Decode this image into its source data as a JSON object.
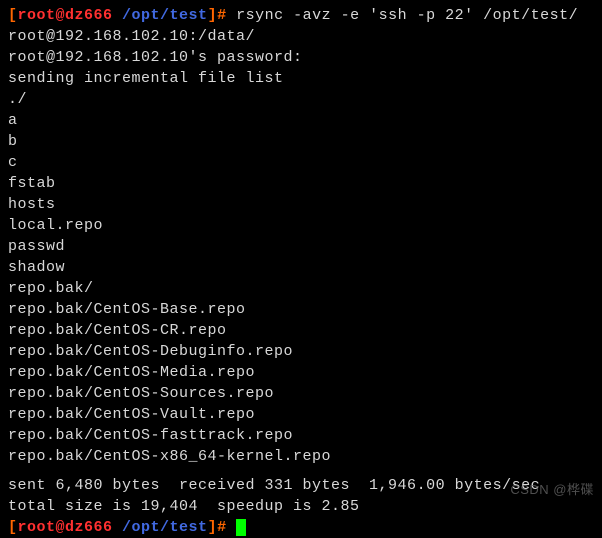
{
  "prompt1": {
    "bracket_l": "[",
    "user": "root@dz666",
    "cwd": "/opt/test",
    "bracket_r": "]#",
    "command": " rsync -avz -e 'ssh -p 22' /opt/test/ root@192.168.102.10:/data/"
  },
  "output": {
    "pw_prompt": "root@192.168.102.10's password:",
    "sending": "sending incremental file list",
    "files": [
      "./",
      "a",
      "b",
      "c",
      "fstab",
      "hosts",
      "local.repo",
      "passwd",
      "shadow",
      "repo.bak/",
      "repo.bak/CentOS-Base.repo",
      "repo.bak/CentOS-CR.repo",
      "repo.bak/CentOS-Debuginfo.repo",
      "repo.bak/CentOS-Media.repo",
      "repo.bak/CentOS-Sources.repo",
      "repo.bak/CentOS-Vault.repo",
      "repo.bak/CentOS-fasttrack.repo",
      "repo.bak/CentOS-x86_64-kernel.repo"
    ],
    "summary1": "sent 6,480 bytes  received 331 bytes  1,946.00 bytes/sec",
    "summary2": "total size is 19,404  speedup is 2.85"
  },
  "prompt2": {
    "bracket_l": "[",
    "user": "root@dz666",
    "cwd": "/opt/test",
    "bracket_r": "]#",
    "command": " "
  },
  "watermark": "CSDN @桦碟"
}
